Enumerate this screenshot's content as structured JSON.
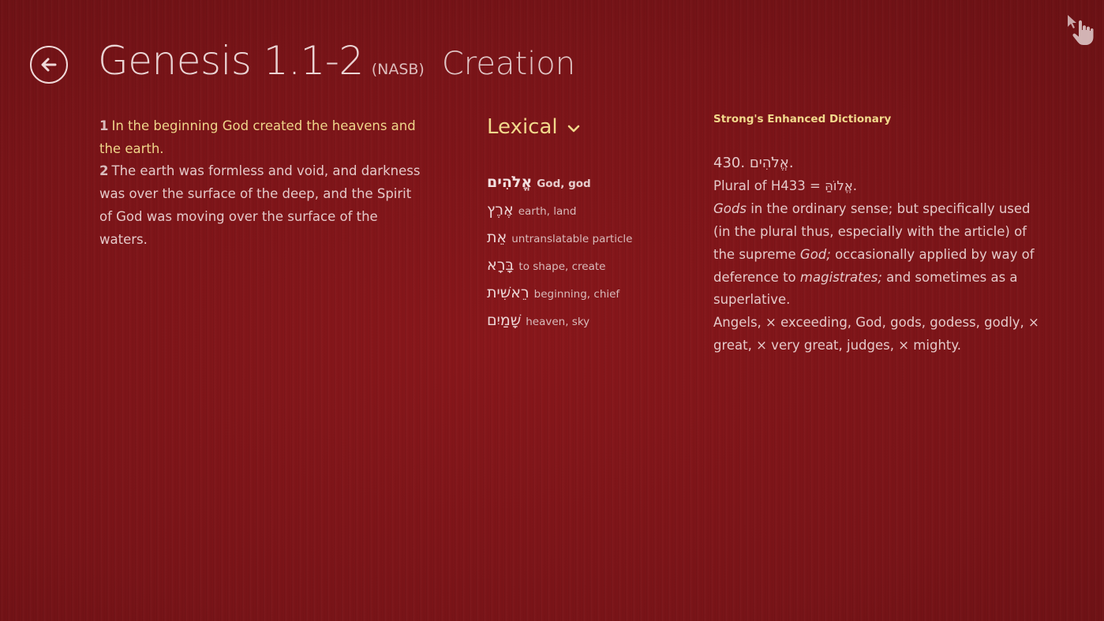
{
  "header": {
    "title": "Genesis 1.1-2",
    "version": "(NASB)",
    "subtitle": "Creation"
  },
  "icons": {
    "back": "arrow-left-circle-icon",
    "pointer": "hand-pointer-icon"
  },
  "verses": [
    {
      "number": "1",
      "text": "In the beginning God created the heavens and the earth.",
      "active": true
    },
    {
      "number": "2",
      "text": "The earth was formless and void, and darkness was over the surface of the deep, and the Spirit of God was moving over the surface of the waters.",
      "active": false
    }
  ],
  "lexical": {
    "label": "Lexical",
    "items": [
      {
        "hebrew": "אֱלֹהִים",
        "gloss": "God, god",
        "selected": true
      },
      {
        "hebrew": "אֶרֶץ",
        "gloss": "earth, land",
        "selected": false
      },
      {
        "hebrew": "אֵת",
        "gloss": "untranslatable particle",
        "selected": false
      },
      {
        "hebrew": "בָּרָא",
        "gloss": "to shape, create",
        "selected": false
      },
      {
        "hebrew": "רֵאשִׁית",
        "gloss": "beginning, chief",
        "selected": false
      },
      {
        "hebrew": "שָׁמַיִם",
        "gloss": "heaven, sky",
        "selected": false
      }
    ]
  },
  "dictionary": {
    "title": "Strong's Enhanced Dictionary",
    "entry": "430. אֱלֹהִים.",
    "plural_of": "Plural of H433 = אֱלוֹהַּ.",
    "def_p1_word": "Gods",
    "def_p1_rest": " in the ordinary sense; but specifically used (in the plural thus, especially with the article) of the supreme ",
    "def_p2_word": "God;",
    "def_p2_rest": " occasionally applied by way of deference to ",
    "def_p3_word": "magistrates;",
    "def_p3_rest": " and sometimes as a superlative.",
    "translations": "Angels, × exceeding, God, gods, godess, godly, × great, × very great, judges, × mighty."
  },
  "colors": {
    "background": "#7a1418",
    "accent": "#f1d98c",
    "text": "#e4c9c9"
  }
}
